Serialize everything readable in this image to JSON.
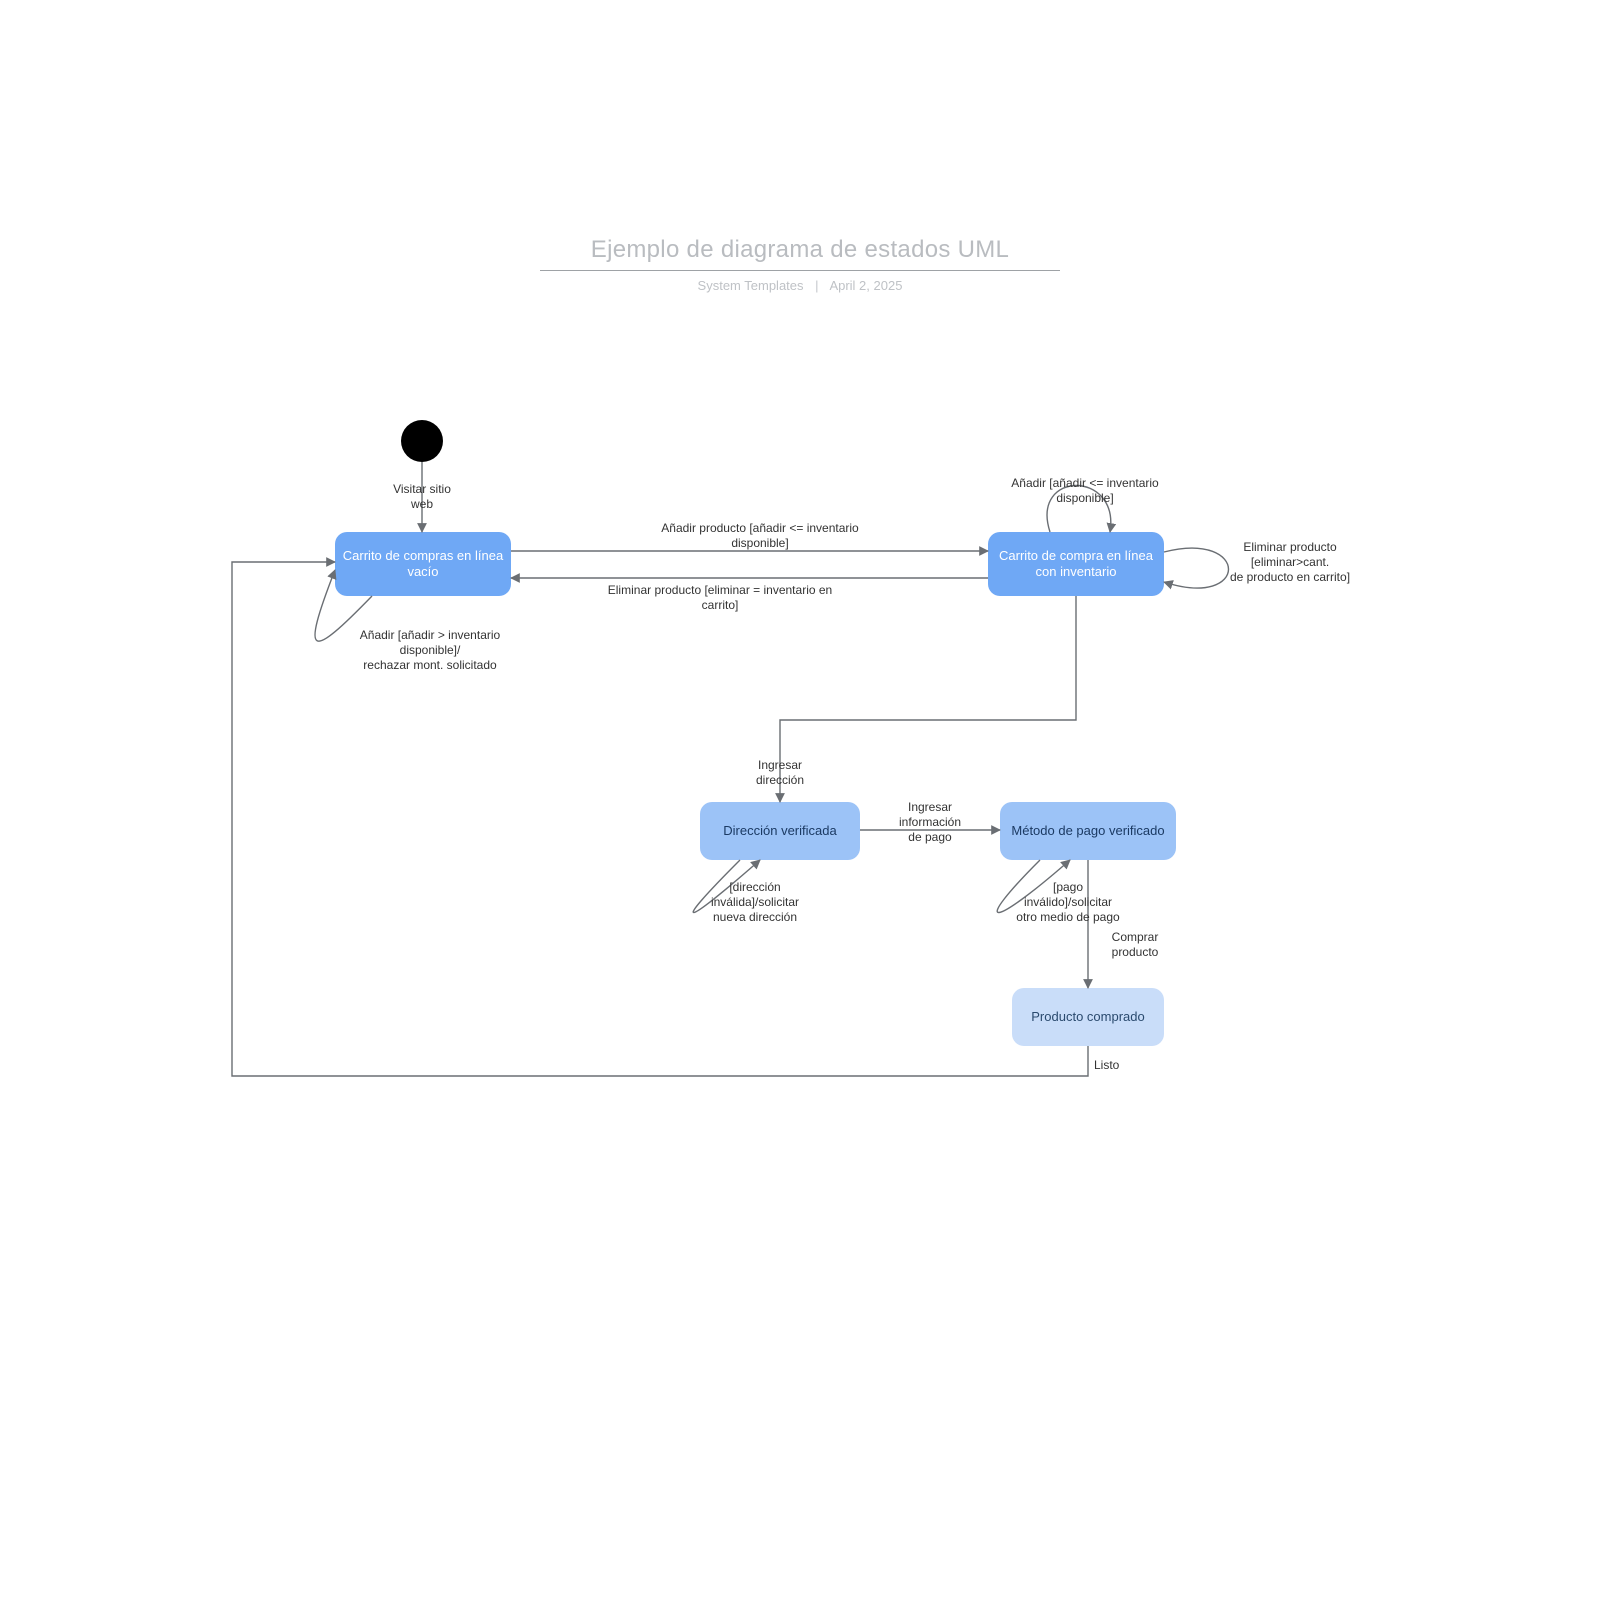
{
  "header": {
    "title": "Ejemplo de diagrama de estados UML",
    "subLeft": "System Templates",
    "subRight": "April 2, 2025"
  },
  "states": {
    "emptyCart": "Carrito de\ncompras en línea\nvacío",
    "cartWithInv": "Carrito de compra\nen línea con\ninventario",
    "addressVerified": "Dirección\nverificada",
    "paymentVerified": "Método de pago\nverificado",
    "purchased": "Producto\ncomprado"
  },
  "transitions": {
    "visit": "Visitar sitio\nweb",
    "addProduct": "Añadir producto [añadir <= inventario\ndisponible]",
    "removeProduct": "Eliminar producto [eliminar = inventario en\ncarrito]",
    "addSelf": "Añadir [añadir <= inventario\ndisponible]",
    "removeSelf": "Eliminar producto\n[eliminar>cant.\nde producto en carrito]",
    "addRejected": "Añadir [añadir > inventario\ndisponible]/\nrechazar mont. solicitado",
    "enterAddress": "Ingresar\ndirección",
    "invalidAddress": "[dirección\ninválida]/solicitar\nnueva dirección",
    "enterPayment": "Ingresar\ninformación\nde pago",
    "invalidPayment": "[pago\ninválido]/solicitar\notro medio de pago",
    "buy": "Comprar\nproducto",
    "done": "Listo"
  }
}
